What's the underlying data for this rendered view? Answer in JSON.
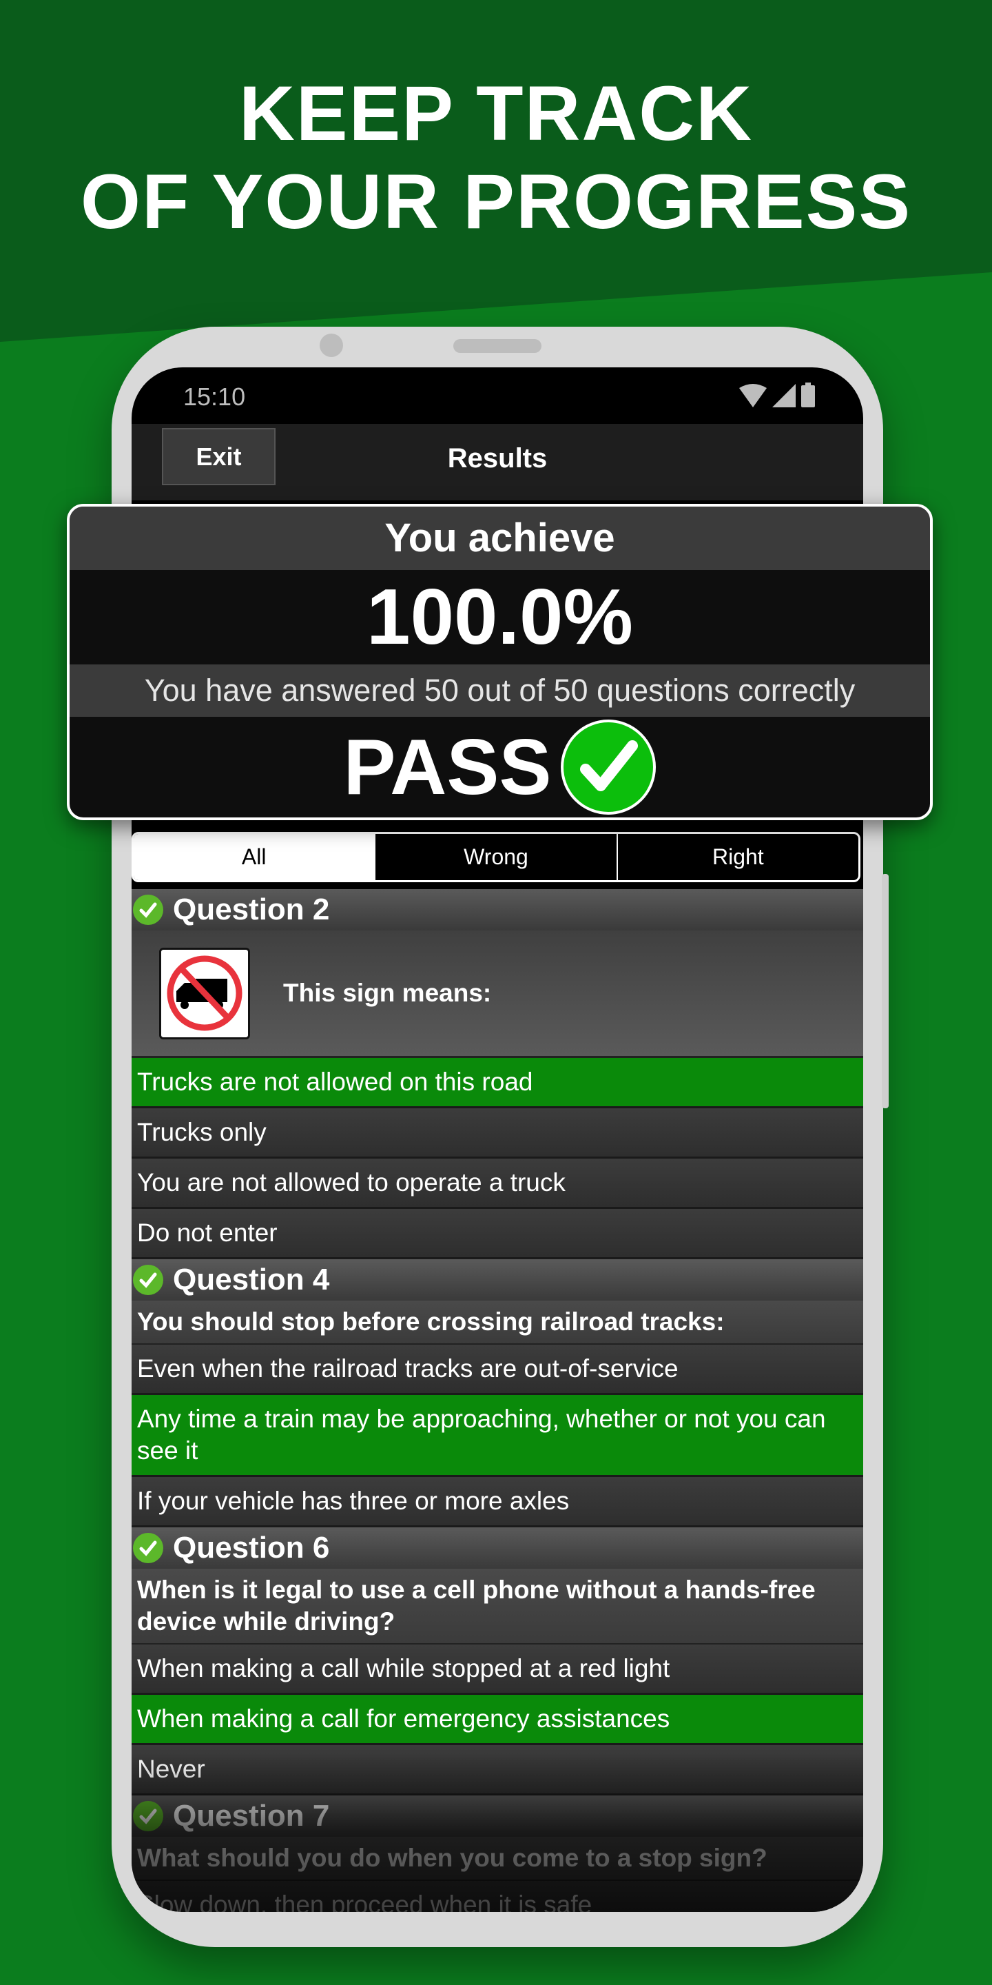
{
  "promo": {
    "line1": "KEEP TRACK",
    "line2": "OF YOUR PROGRESS"
  },
  "colors": {
    "bg_top": "#0a5c1b",
    "bg_bottom": "#0b7d1e",
    "correct": "#0a8a0a",
    "check": "#0cbe0c"
  },
  "status": {
    "time": "15:10",
    "icons": [
      "wifi-icon",
      "signal-icon",
      "battery-icon"
    ]
  },
  "toolbar": {
    "exit_label": "Exit",
    "title": "Results"
  },
  "result": {
    "heading": "You achieve",
    "score": "100.0%",
    "summary": "You have answered 50 out of 50 questions correctly",
    "verdict": "PASS"
  },
  "tabs": [
    "All",
    "Wrong",
    "Right"
  ],
  "selected_tab": "All",
  "questions": [
    {
      "title": "Question 2",
      "text": "This sign means:",
      "image": "no-trucks-sign",
      "answers": [
        {
          "text": "Trucks are not allowed on this road",
          "correct": true
        },
        {
          "text": "Trucks only"
        },
        {
          "text": "You are not allowed to operate a truck"
        },
        {
          "text": "Do not enter"
        }
      ]
    },
    {
      "title": "Question 4",
      "text": "You should stop before crossing railroad tracks:",
      "answers": [
        {
          "text": "Even when the railroad tracks are out-of-service"
        },
        {
          "text": "Any time a train may be approaching, whether or not you can see it",
          "correct": true
        },
        {
          "text": "If your vehicle has three or more axles"
        }
      ]
    },
    {
      "title": "Question 6",
      "text": "When is it legal to use a cell phone without a hands-free device while driving?",
      "answers": [
        {
          "text": "When making a call while stopped at a red light"
        },
        {
          "text": "When making a call for emergency assistances",
          "correct": true
        },
        {
          "text": "Never"
        }
      ]
    },
    {
      "title": "Question 7",
      "text": "What should you do when you come to a stop sign?",
      "answers": [
        {
          "text": "Slow down, then proceed when it is safe"
        }
      ]
    }
  ]
}
